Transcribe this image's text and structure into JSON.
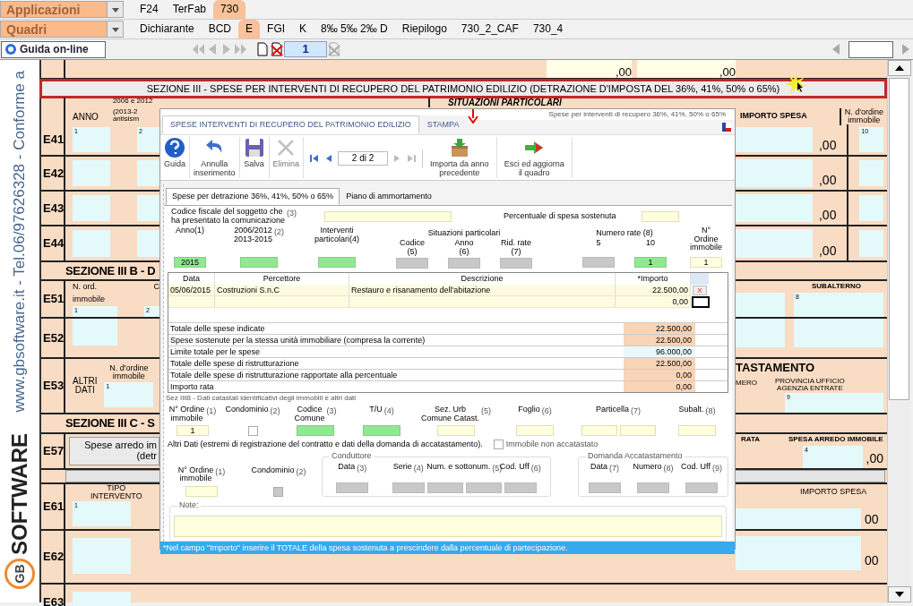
{
  "app_bar": {
    "dropdown": "Applicazioni",
    "tabs": [
      {
        "label": "F24",
        "selected": false
      },
      {
        "label": "TerFab",
        "selected": false
      },
      {
        "label": "730",
        "selected": true
      }
    ]
  },
  "quadri_bar": {
    "dropdown": "Quadri",
    "tabs": [
      {
        "label": "Dichiarante",
        "selected": false
      },
      {
        "label": "BCD",
        "selected": false
      },
      {
        "label": "E",
        "selected": true
      },
      {
        "label": "FGI",
        "selected": false
      },
      {
        "label": "K",
        "selected": false
      },
      {
        "label": "8‰ 5‰ 2‰ D",
        "selected": false
      },
      {
        "label": "Riepilogo",
        "selected": false
      },
      {
        "label": "730_2_CAF",
        "selected": false
      },
      {
        "label": "730_4",
        "selected": false
      }
    ]
  },
  "toolbar": {
    "help_button": "Guida on-line",
    "page": "1"
  },
  "side_text": "www.gbsoftware.it - Tel.06/97626328 - Conforme a",
  "logo": {
    "mark": "GB",
    "text": "SOFTWARE"
  },
  "form": {
    "top_amounts": [
      ",00",
      ",00"
    ],
    "section_title": "SEZIONE III - SPESE PER INTERVENTI DI RECUPERO DEL PATRIMONIO EDILIZIO (DETRAZIONE D'IMPOSTA DEL 36%, 41%, 50% o 65%)",
    "header": {
      "anno": "ANNO",
      "years_top": "2006 e 2012",
      "years": "(2013-2\nantisism",
      "situazioni": "SITUAZIONI PARTICOLARI",
      "importo": "IMPORTO SPESA",
      "ordine": "N. d'ordine\nimmobile"
    },
    "rows_a": [
      {
        "code": "E41",
        "amount": ",00",
        "nums": [
          "1",
          "2",
          "10"
        ]
      },
      {
        "code": "E42",
        "amount": ",00"
      },
      {
        "code": "E43",
        "amount": ",00"
      },
      {
        "code": "E44",
        "amount": ",00"
      }
    ],
    "section_b": "SEZIONE III B - D",
    "rows_b": [
      {
        "code": "E51",
        "left_label": "N. ord. immobile",
        "cut_label": "C",
        "nums": [
          "1",
          "2"
        ],
        "right_label": "SUBALTERNO",
        "right_num": "8"
      },
      {
        "code": "E52"
      },
      {
        "code": "E53",
        "side_label": "ALTRI\nDATI",
        "left_label": "N. d'ordine\nimmobile",
        "nums": [
          "1"
        ],
        "right_title": "TASTAMENTO",
        "right_label": "MERO",
        "right_label2": "PROVINCIA UFFICIO\nAGENZIA ENTRATE",
        "right_num": "9"
      }
    ],
    "section_c": "SEZIONE III C - S",
    "row_c": {
      "code": "E57",
      "button": "Spese arredo im\n(detr",
      "right_label": "RATA",
      "right_label2": "SPESA ARREDO IMMOBILE",
      "right_num": "4",
      "amount": ",00"
    },
    "rows_d": [
      {
        "code": "E61",
        "left_label": "TIPO\nINTERVENTO",
        "nums": [
          "1"
        ],
        "right_label": "IMPORTO SPESA",
        "amount": "00"
      },
      {
        "code": "E62",
        "amount": "00"
      },
      {
        "code": "E63"
      }
    ]
  },
  "dialog": {
    "title": "Spese per interventi di recupero 36%, 41%, 50% o 65%",
    "tabs": [
      {
        "label": "SPESE INTERVENTI DI RECUPERO DEL PATRIMONIO EDILIZIO",
        "selected": true
      },
      {
        "label": "STAMPA",
        "selected": false
      }
    ],
    "actions": [
      {
        "kind": "help",
        "label": "Guida",
        "disabled": false
      },
      {
        "kind": "undo",
        "label": "Annulla\ninserimento",
        "disabled": false
      },
      {
        "kind": "save",
        "label": "Salva",
        "disabled": false
      },
      {
        "kind": "delete",
        "label": "Elimina",
        "disabled": true
      },
      {
        "kind": "pager",
        "label": "2 di 2"
      },
      {
        "kind": "import",
        "label": "Importa da anno\nprecedente",
        "disabled": false
      },
      {
        "kind": "exit",
        "label": "Esci ed aggiorna\nil quadro",
        "disabled": false
      }
    ],
    "inner_tabs": [
      {
        "label": "Spese per detrazione 36%, 41%, 50% o 65%",
        "selected": true
      },
      {
        "label": "Piano di ammortamento",
        "selected": false
      }
    ],
    "cf": {
      "label": "Codice fiscale del soggetto che\nha presentato la comunicazione",
      "ref": "(3)",
      "pct_label": "Percentuale di spesa sostenuta"
    },
    "situazioni": [
      {
        "label": "Anno(1)",
        "fields": [
          {
            "kind": "required",
            "value": "2015"
          }
        ]
      },
      {
        "label": "2006/2012\n2013-2015",
        "ref": "(2)",
        "fields": [
          {
            "kind": "required"
          }
        ]
      },
      {
        "label": "Interventi\nparticolari(4)",
        "fields": [
          {
            "kind": "required"
          }
        ]
      },
      {
        "group": "Situazioni particolari",
        "columns": [
          {
            "label": "Codice\n(5)",
            "fields": [
              {
                "kind": "disabled"
              }
            ]
          },
          {
            "label": "Anno\n(6)",
            "fields": [
              {
                "kind": "disabled"
              }
            ]
          },
          {
            "label": "Rid. rate\n(7)",
            "fields": [
              {
                "kind": "disabled"
              }
            ]
          }
        ]
      },
      {
        "group": "Numero rate (8)",
        "columns": [
          {
            "label": "5",
            "fields": [
              {
                "kind": "disabled"
              }
            ]
          },
          {
            "label": "10",
            "fields": [
              {
                "kind": "required",
                "value": "1"
              }
            ]
          }
        ]
      },
      {
        "label": "N°\nOrdine\nimmobile",
        "fields": [
          {
            "kind": "input",
            "value": "1"
          }
        ]
      }
    ],
    "table": {
      "columns": [
        "Data",
        "Percettore",
        "Descrizione",
        "*Importo"
      ],
      "rows": [
        {
          "data": "05/06/2015",
          "percettore": "Costruzioni S.n.C",
          "descrizione": "Restauro e risanamento dell'abitazione",
          "importo": "22.500,00",
          "delete": "X"
        },
        {
          "importo": "0,00"
        }
      ]
    },
    "totals": [
      {
        "label": "Totale delle spese indicate",
        "value": "22.500,00",
        "kind": "computed"
      },
      {
        "label": "Spese sostenute per la stessa unità immobiliare (compresa la corrente)",
        "value": "22.500,00",
        "kind": "computed"
      },
      {
        "label": "Limite totale per le spese",
        "value": "96.000,00",
        "kind": "limit"
      },
      {
        "label": "Totale delle spese di ristrutturazione",
        "value": "22.500,00",
        "kind": "computed"
      },
      {
        "label": "Totale delle spese di ristrutturazione rapportate alla percentuale",
        "value": "0,00",
        "kind": "computed"
      },
      {
        "label": "Importo rata",
        "value": "0,00",
        "kind": "computed"
      }
    ],
    "catasto_caption": "Sez IIIB - Dati catastali identificativi degli immobili e altri dati",
    "catasto": [
      {
        "label": "N° Ordine\nimmobile",
        "ref": "(1)",
        "fields": [
          {
            "kind": "input",
            "value": "1"
          }
        ]
      },
      {
        "label": "Condominio",
        "ref": "(2)",
        "fields": [
          {
            "kind": "checkbox",
            "checked": false,
            "disabled": false
          }
        ]
      },
      {
        "label": "Codice\nComune",
        "ref": "(3)",
        "fields": [
          {
            "kind": "required"
          }
        ]
      },
      {
        "label": "T/U",
        "ref": "(4)",
        "fields": [
          {
            "kind": "required"
          }
        ]
      },
      {
        "label": "Sez. Urb\nComune Catast.",
        "ref": "(5)",
        "fields": [
          {
            "kind": "input"
          }
        ]
      },
      {
        "label": "Foglio",
        "ref": "(6)",
        "fields": [
          {
            "kind": "input"
          }
        ]
      },
      {
        "label": "Particella",
        "ref": "(7)",
        "fields": [
          {
            "kind": "input"
          },
          {
            "kind": "input"
          }
        ]
      },
      {
        "label": "Subalt.",
        "ref": "(8)",
        "fields": [
          {
            "kind": "input"
          }
        ]
      }
    ],
    "altri_caption": "Altri Dati (estremi di registrazione del contratto e dati della domanda di accatastamento).",
    "non_accatastato": {
      "label": "Immobile non accatastato",
      "checked": false
    },
    "altri": [
      {
        "label": "N° Ordine\nimmobile",
        "ref": "(1)",
        "fields": [
          {
            "kind": "input"
          }
        ]
      },
      {
        "label": "Condominio",
        "ref": "(2)",
        "fields": [
          {
            "kind": "checkbox",
            "checked": false,
            "disabled": true
          }
        ]
      },
      {
        "group": "Conduttore",
        "columns": [
          {
            "label": "Data",
            "ref": "(3)",
            "fields": [
              {
                "kind": "disabled"
              }
            ]
          },
          {
            "label": "Serie",
            "ref": "(4)",
            "fields": [
              {
                "kind": "disabled"
              }
            ]
          },
          {
            "label": "Num. e sottonum.",
            "ref": "(5)",
            "fields": [
              {
                "kind": "disabled"
              },
              {
                "kind": "disabled"
              }
            ]
          },
          {
            "label": "Cod. Uff",
            "ref": "(6)",
            "fields": [
              {
                "kind": "disabled"
              }
            ]
          }
        ]
      },
      {
        "group": "Domanda Accatastamento",
        "columns": [
          {
            "label": "Data",
            "ref": "(7)",
            "fields": [
              {
                "kind": "disabled"
              }
            ]
          },
          {
            "label": "Numero",
            "ref": "(8)",
            "fields": [
              {
                "kind": "disabled"
              }
            ]
          },
          {
            "label": "Cod. Uff",
            "ref": "(9)",
            "fields": [
              {
                "kind": "disabled"
              }
            ]
          }
        ]
      }
    ],
    "note_label": "Note:",
    "info": "*Nel campo \"Importo\" inserire il TOTALE della spesa sostenuta a prescindere dalla percentuale di partecipazione."
  }
}
